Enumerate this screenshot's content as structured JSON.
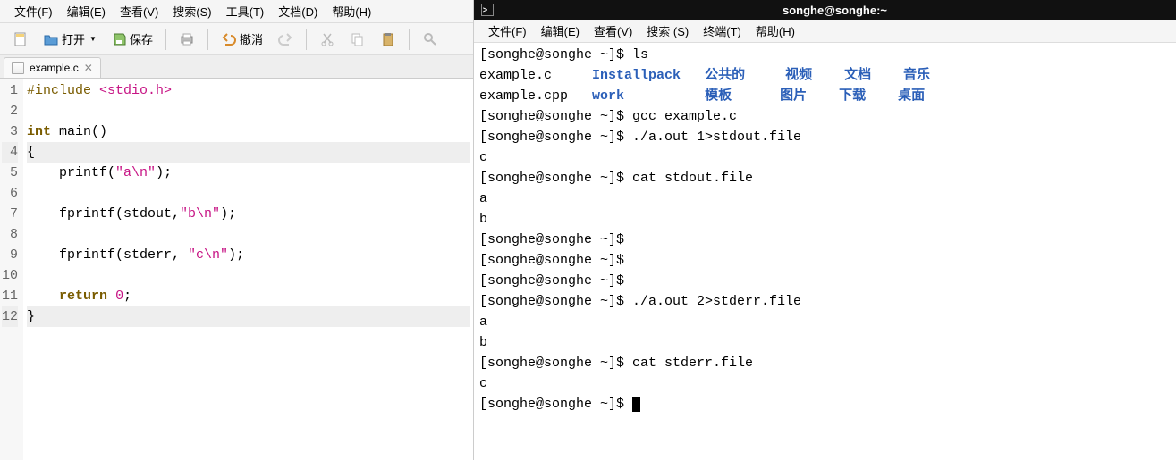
{
  "editor": {
    "menu": {
      "file": "文件(F)",
      "edit": "编辑(E)",
      "view": "查看(V)",
      "search": "搜索(S)",
      "tools": "工具(T)",
      "documents": "文档(D)",
      "help": "帮助(H)"
    },
    "toolbar": {
      "open": "打开",
      "save": "保存",
      "undo": "撤消"
    },
    "tabs": [
      {
        "label": "example.c"
      }
    ],
    "code": {
      "lines": [
        {
          "n": "1",
          "segs": [
            [
              "#include ",
              "pp"
            ],
            [
              "<stdio.h>",
              "inc"
            ]
          ]
        },
        {
          "n": "2",
          "segs": []
        },
        {
          "n": "3",
          "segs": [
            [
              "int",
              "kw"
            ],
            [
              " main()",
              ""
            ]
          ]
        },
        {
          "n": "4",
          "segs": [
            [
              "{",
              ""
            ]
          ],
          "hl": true
        },
        {
          "n": "5",
          "segs": [
            [
              "    printf(",
              ""
            ],
            [
              "\"a\\n\"",
              "str"
            ],
            [
              ");",
              ""
            ]
          ]
        },
        {
          "n": "6",
          "segs": []
        },
        {
          "n": "7",
          "segs": [
            [
              "    fprintf(stdout,",
              ""
            ],
            [
              "\"b\\n\"",
              "str"
            ],
            [
              ");",
              ""
            ]
          ]
        },
        {
          "n": "8",
          "segs": []
        },
        {
          "n": "9",
          "segs": [
            [
              "    fprintf(stderr, ",
              ""
            ],
            [
              "\"c\\n\"",
              "str"
            ],
            [
              ");",
              ""
            ]
          ]
        },
        {
          "n": "10",
          "segs": []
        },
        {
          "n": "11",
          "segs": [
            [
              "    ",
              ""
            ],
            [
              "return",
              "kw"
            ],
            [
              " ",
              ""
            ],
            [
              "0",
              "num"
            ],
            [
              ";",
              ""
            ]
          ]
        },
        {
          "n": "12",
          "segs": [
            [
              "}",
              ""
            ]
          ],
          "hl": true
        }
      ]
    }
  },
  "terminal": {
    "title": "songhe@songhe:~",
    "menu": {
      "file": "文件(F)",
      "edit": "编辑(E)",
      "view": "查看(V)",
      "search": "搜索 (S)",
      "terminal": "终端(T)",
      "help": "帮助(H)"
    },
    "ls": {
      "cols": [
        [
          "example.c",
          "",
          "Installpack",
          "blue",
          "公共的",
          "blue",
          "视频",
          "blue",
          "文档",
          "blue",
          "音乐",
          "blue"
        ],
        [
          "example.cpp",
          "",
          "work",
          "blue",
          "模板",
          "blue",
          "图片",
          "blue",
          "下载",
          "blue",
          "桌面",
          "blue"
        ]
      ]
    },
    "lines": [
      {
        "type": "prompt",
        "cmd": "ls"
      },
      {
        "type": "lsrow",
        "row": 0
      },
      {
        "type": "lsrow",
        "row": 1
      },
      {
        "type": "prompt",
        "cmd": "gcc example.c"
      },
      {
        "type": "prompt",
        "cmd": "./a.out 1>stdout.file"
      },
      {
        "type": "out",
        "text": "c"
      },
      {
        "type": "prompt",
        "cmd": "cat stdout.file"
      },
      {
        "type": "out",
        "text": "a"
      },
      {
        "type": "out",
        "text": "b"
      },
      {
        "type": "prompt",
        "cmd": ""
      },
      {
        "type": "prompt",
        "cmd": ""
      },
      {
        "type": "prompt",
        "cmd": ""
      },
      {
        "type": "prompt",
        "cmd": "./a.out 2>stderr.file"
      },
      {
        "type": "out",
        "text": "a"
      },
      {
        "type": "out",
        "text": "b"
      },
      {
        "type": "prompt",
        "cmd": "cat stderr.file"
      },
      {
        "type": "out",
        "text": "c"
      },
      {
        "type": "prompt",
        "cmd": "",
        "cursor": true
      }
    ],
    "prompt": "[songhe@songhe ~]$ "
  }
}
